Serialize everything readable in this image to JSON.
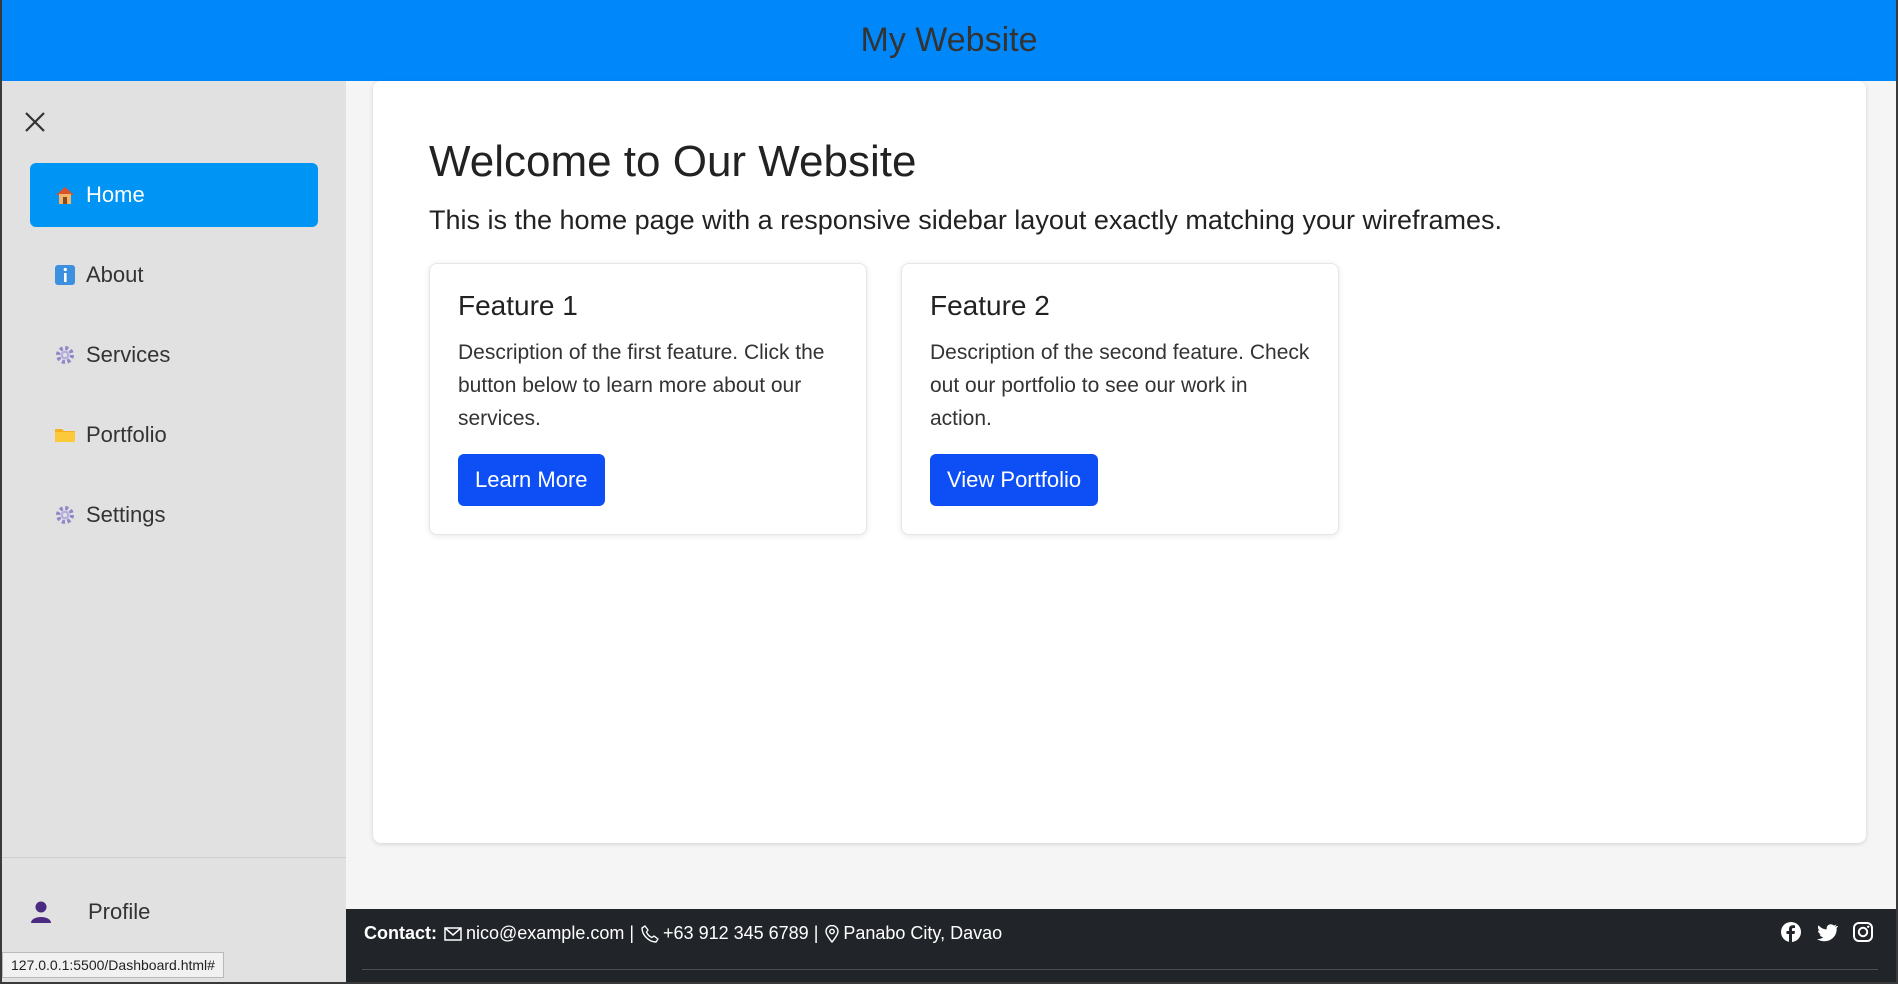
{
  "header": {
    "title": "My Website"
  },
  "sidebar": {
    "close_icon": "close-icon",
    "items": [
      {
        "label": "Home",
        "icon": "house-icon",
        "active": true
      },
      {
        "label": "About",
        "icon": "info-icon",
        "active": false
      },
      {
        "label": "Services",
        "icon": "gear-icon",
        "active": false
      },
      {
        "label": "Portfolio",
        "icon": "folder-icon",
        "active": false
      },
      {
        "label": "Settings",
        "icon": "gear-icon",
        "active": false
      }
    ],
    "profile": {
      "label": "Profile",
      "icon": "user-icon"
    }
  },
  "main": {
    "heading": "Welcome to Our Website",
    "subheading": "This is the home page with a responsive sidebar layout exactly matching your wireframes.",
    "cards": [
      {
        "title": "Feature 1",
        "description": "Description of the first feature. Click the button below to learn more about our services.",
        "button": "Learn More"
      },
      {
        "title": "Feature 2",
        "description": "Description of the second feature. Check out our portfolio to see our work in action.",
        "button": "View Portfolio"
      }
    ]
  },
  "footer": {
    "contact_label": "Contact:",
    "email": "nico@example.com",
    "phone": "+63 912 345 6789",
    "location": "Panabo City, Davao",
    "separator": "|",
    "social": [
      "facebook-icon",
      "twitter-icon",
      "instagram-icon"
    ]
  },
  "status_bar": {
    "url": "127.0.0.1:5500/Dashboard.html#"
  },
  "colors": {
    "header_bg": "#0088fb",
    "active_nav": "#0094f4",
    "button": "#0d4ff5",
    "footer_bg": "#212529",
    "sidebar_bg": "#e1e1e1"
  }
}
